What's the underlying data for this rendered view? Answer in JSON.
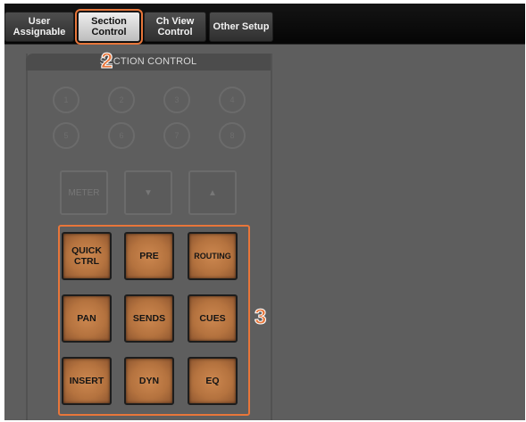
{
  "tabs": [
    {
      "label": "User\nAssignable",
      "active": false
    },
    {
      "label": "Section\nControl",
      "active": true
    },
    {
      "label": "Ch View\nControl",
      "active": false
    },
    {
      "label": "Other Setup",
      "active": false
    }
  ],
  "panel": {
    "title": "SECTION CONTROL"
  },
  "number_buttons": [
    "1",
    "2",
    "3",
    "4",
    "5",
    "6",
    "7",
    "8"
  ],
  "nav_buttons": [
    {
      "label": "METER"
    },
    {
      "label": "▼",
      "icon": "arrow-down-icon"
    },
    {
      "label": "▲",
      "icon": "arrow-up-icon"
    }
  ],
  "section_buttons": [
    {
      "label": "QUICK\nCTRL"
    },
    {
      "label": "PRE"
    },
    {
      "label": "ROUTING"
    },
    {
      "label": "PAN"
    },
    {
      "label": "SENDS"
    },
    {
      "label": "CUES"
    },
    {
      "label": "INSERT"
    },
    {
      "label": "DYN"
    },
    {
      "label": "EQ"
    }
  ],
  "callouts": {
    "tab_marker": "2",
    "buttons_marker": "3"
  },
  "colors": {
    "accent": "#e8763a",
    "background": "#5e5e5e",
    "button_lit": "#c27f49",
    "topbar": "#0a0a0a"
  }
}
